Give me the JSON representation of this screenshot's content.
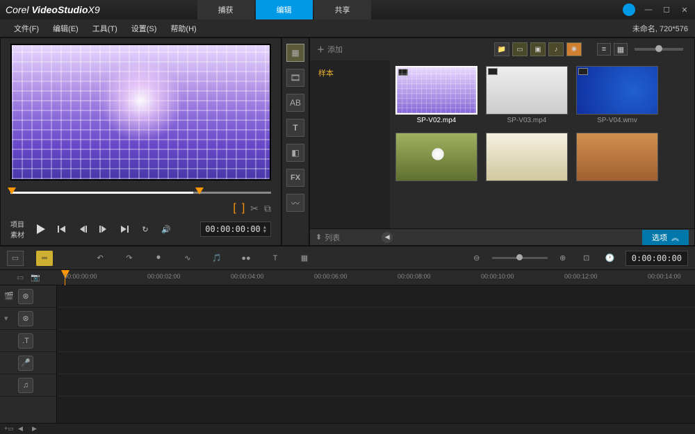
{
  "app": {
    "brand": "Corel",
    "product": "VideoStudio",
    "version": "X9"
  },
  "main_tabs": {
    "capture": "捕获",
    "edit": "编辑",
    "share": "共享"
  },
  "menu": {
    "file": "文件(F)",
    "edit": "编辑(E)",
    "tools": "工具(T)",
    "settings": "设置(S)",
    "help": "帮助(H)"
  },
  "project": {
    "name": "未命名",
    "resolution": "720*576"
  },
  "preview": {
    "mode_project": "项目",
    "mode_clip": "素材",
    "timecode": "00:00:00:00"
  },
  "library": {
    "add_label": "添加",
    "tree_sample": "样本",
    "sort_label": "列表",
    "options_label": "选项",
    "clips": [
      {
        "name": "SP-V02.mp4"
      },
      {
        "name": "SP-V03.mp4"
      },
      {
        "name": "SP-V04.wmv"
      },
      {
        "name": ""
      },
      {
        "name": ""
      },
      {
        "name": ""
      }
    ]
  },
  "timeline": {
    "ruler": [
      "00:00:00:00",
      "00:00:02:00",
      "00:00:04:00",
      "00:00:06:00",
      "00:00:08:00",
      "00:00:10:00",
      "00:00:12:00",
      "00:00:14:00"
    ],
    "timecode": "0:00:00:00"
  }
}
